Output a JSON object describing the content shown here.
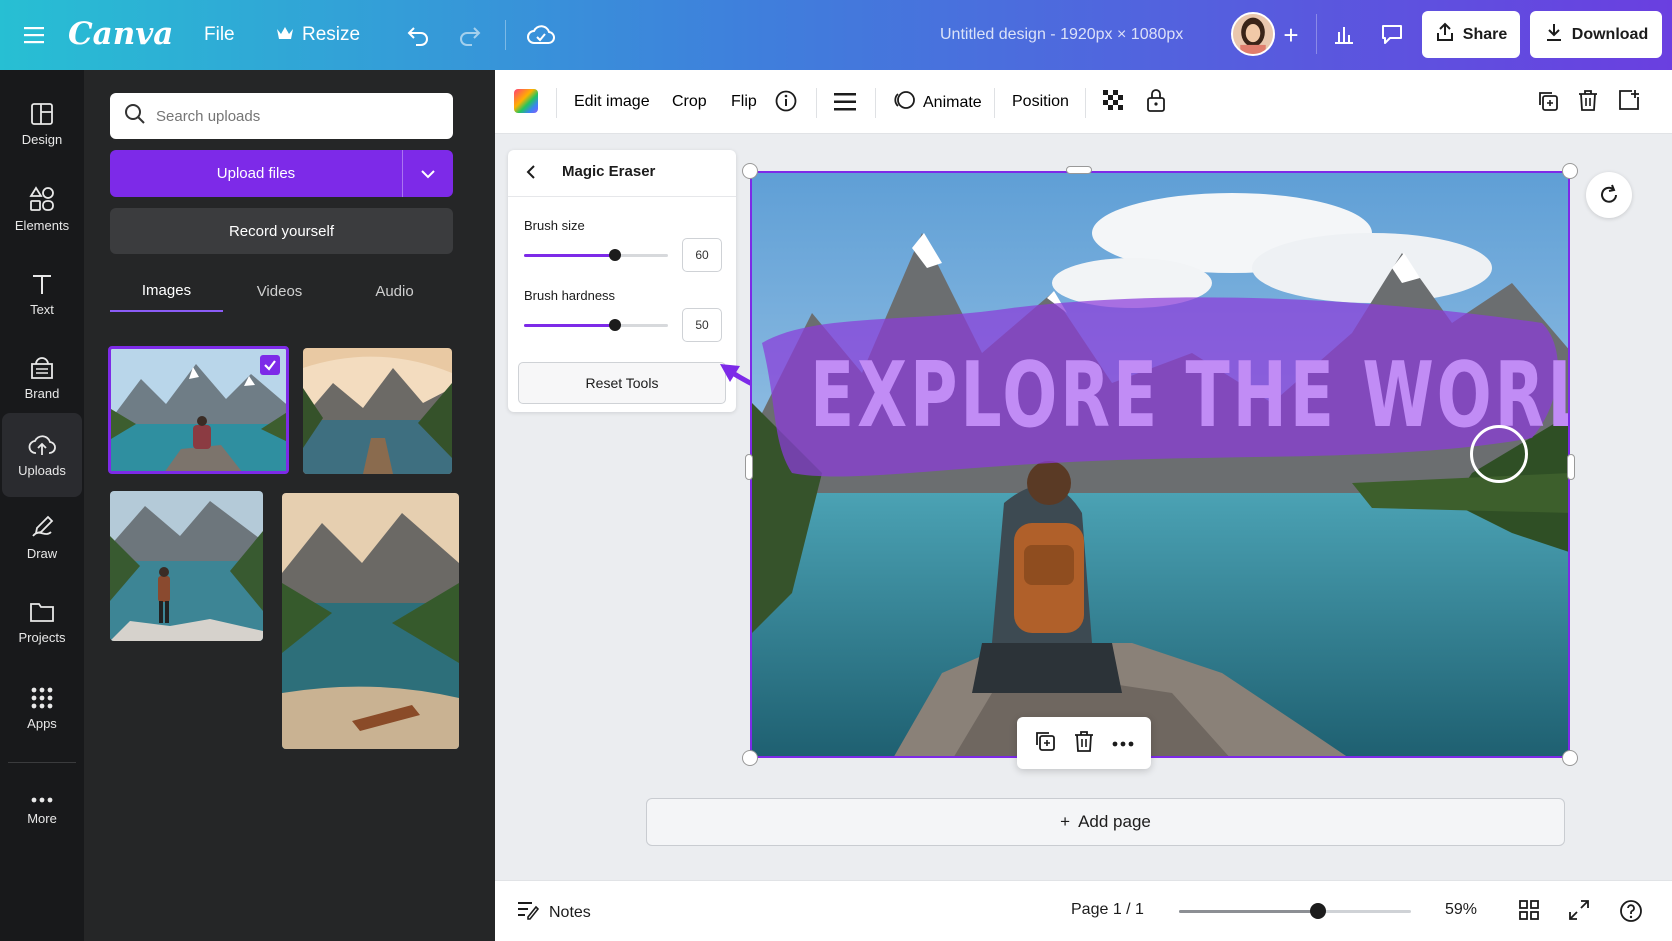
{
  "topbar": {
    "logo": "Canva",
    "file_label": "File",
    "resize_label": "Resize",
    "doc_title": "Untitled design - 1920px × 1080px",
    "share_label": "Share",
    "download_label": "Download"
  },
  "sidebar": {
    "items": [
      {
        "label": "Design",
        "icon": "design-icon"
      },
      {
        "label": "Elements",
        "icon": "elements-icon"
      },
      {
        "label": "Text",
        "icon": "text-icon"
      },
      {
        "label": "Brand",
        "icon": "brand-icon"
      },
      {
        "label": "Uploads",
        "icon": "uploads-icon"
      },
      {
        "label": "Draw",
        "icon": "draw-icon"
      },
      {
        "label": "Projects",
        "icon": "projects-icon"
      },
      {
        "label": "Apps",
        "icon": "apps-icon"
      },
      {
        "label": "More",
        "icon": "more-icon"
      }
    ]
  },
  "panel": {
    "search_placeholder": "Search uploads",
    "upload_label": "Upload files",
    "record_label": "Record yourself",
    "tabs": [
      "Images",
      "Videos",
      "Audio"
    ]
  },
  "toolbar": {
    "edit_image": "Edit image",
    "crop": "Crop",
    "flip": "Flip",
    "animate": "Animate",
    "position": "Position"
  },
  "eraser": {
    "title": "Magic Eraser",
    "brush_size_label": "Brush size",
    "brush_size_value": "60",
    "brush_size_fraction": 0.63,
    "brush_hardness_label": "Brush hardness",
    "brush_hardness_value": "50",
    "brush_hardness_fraction": 0.63,
    "reset_label": "Reset Tools"
  },
  "design": {
    "headline": "EXPLORE THE WORLD"
  },
  "canvas": {
    "add_page_label": "Add page"
  },
  "bottombar": {
    "notes_label": "Notes",
    "page_label": "Page 1 / 1",
    "zoom_label": "59%",
    "zoom_fraction": 0.6
  },
  "colors": {
    "accent": "#7d2ae8",
    "sidebar_bg": "#18191b",
    "panel_bg": "#252627"
  }
}
